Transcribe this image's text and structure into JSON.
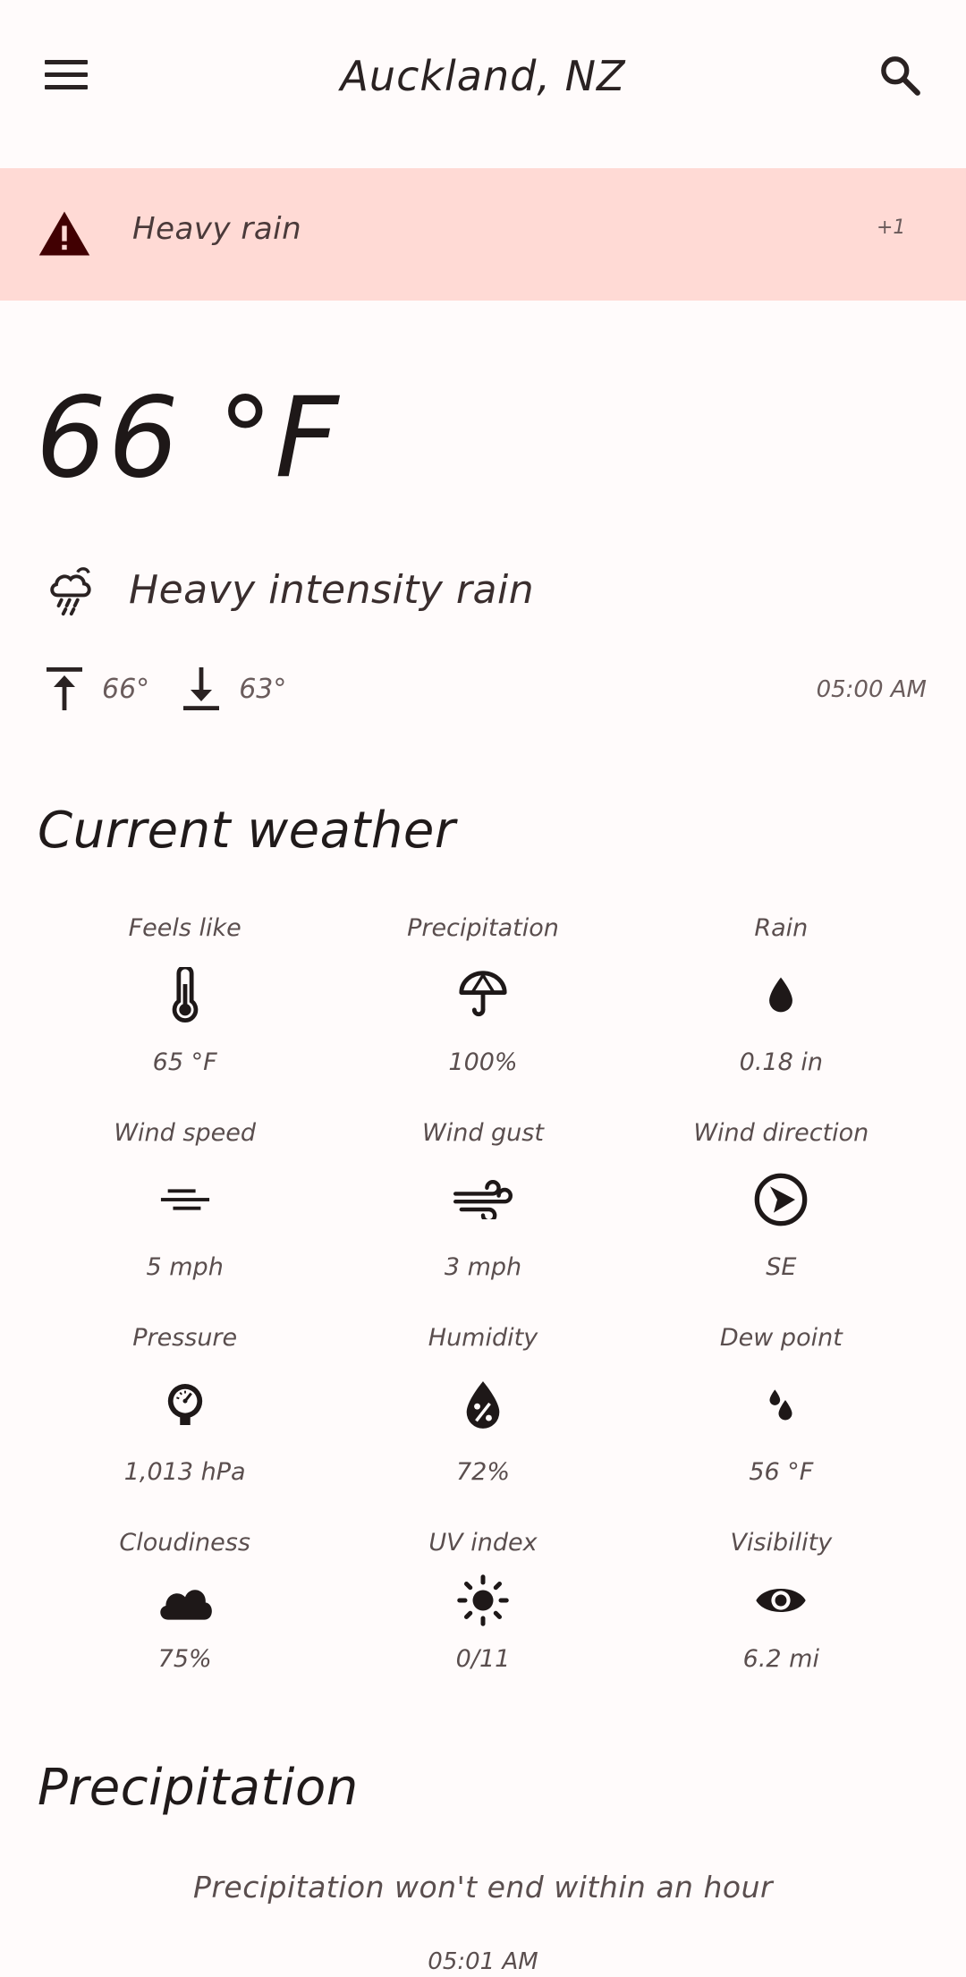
{
  "app_bar": {
    "title": "Auckland, NZ"
  },
  "alert": {
    "text": "Heavy rain",
    "count": "+1"
  },
  "current": {
    "temperature": "66 °F",
    "condition": "Heavy intensity rain",
    "high": "66°",
    "low": "63°",
    "time": "05:00 AM"
  },
  "sections": {
    "current_weather": "Current weather",
    "precipitation": "Precipitation"
  },
  "details": [
    {
      "label": "Feels like",
      "value": "65 °F",
      "icon": "thermometer-icon"
    },
    {
      "label": "Precipitation",
      "value": "100%",
      "icon": "umbrella-icon"
    },
    {
      "label": "Rain",
      "value": "0.18 in",
      "icon": "raindrop-icon"
    },
    {
      "label": "Wind speed",
      "value": "5 mph",
      "icon": "wind-speed-icon"
    },
    {
      "label": "Wind gust",
      "value": "3 mph",
      "icon": "wind-gust-icon"
    },
    {
      "label": "Wind direction",
      "value": "SE",
      "icon": "wind-direction-icon"
    },
    {
      "label": "Pressure",
      "value": "1,013 hPa",
      "icon": "pressure-gauge-icon"
    },
    {
      "label": "Humidity",
      "value": "72%",
      "icon": "humidity-icon"
    },
    {
      "label": "Dew point",
      "value": "56 °F",
      "icon": "dew-point-icon"
    },
    {
      "label": "Cloudiness",
      "value": "75%",
      "icon": "cloud-icon"
    },
    {
      "label": "UV index",
      "value": "0/11",
      "icon": "sun-icon"
    },
    {
      "label": "Visibility",
      "value": "6.2 mi",
      "icon": "eye-icon"
    }
  ],
  "precipitation": {
    "message": "Precipitation won't end within an hour",
    "time": "05:01 AM"
  },
  "colors": {
    "background": "#fffbfb",
    "alert_bg": "#ffdad5",
    "alert_icon": "#410002",
    "text": "#201a1a"
  }
}
